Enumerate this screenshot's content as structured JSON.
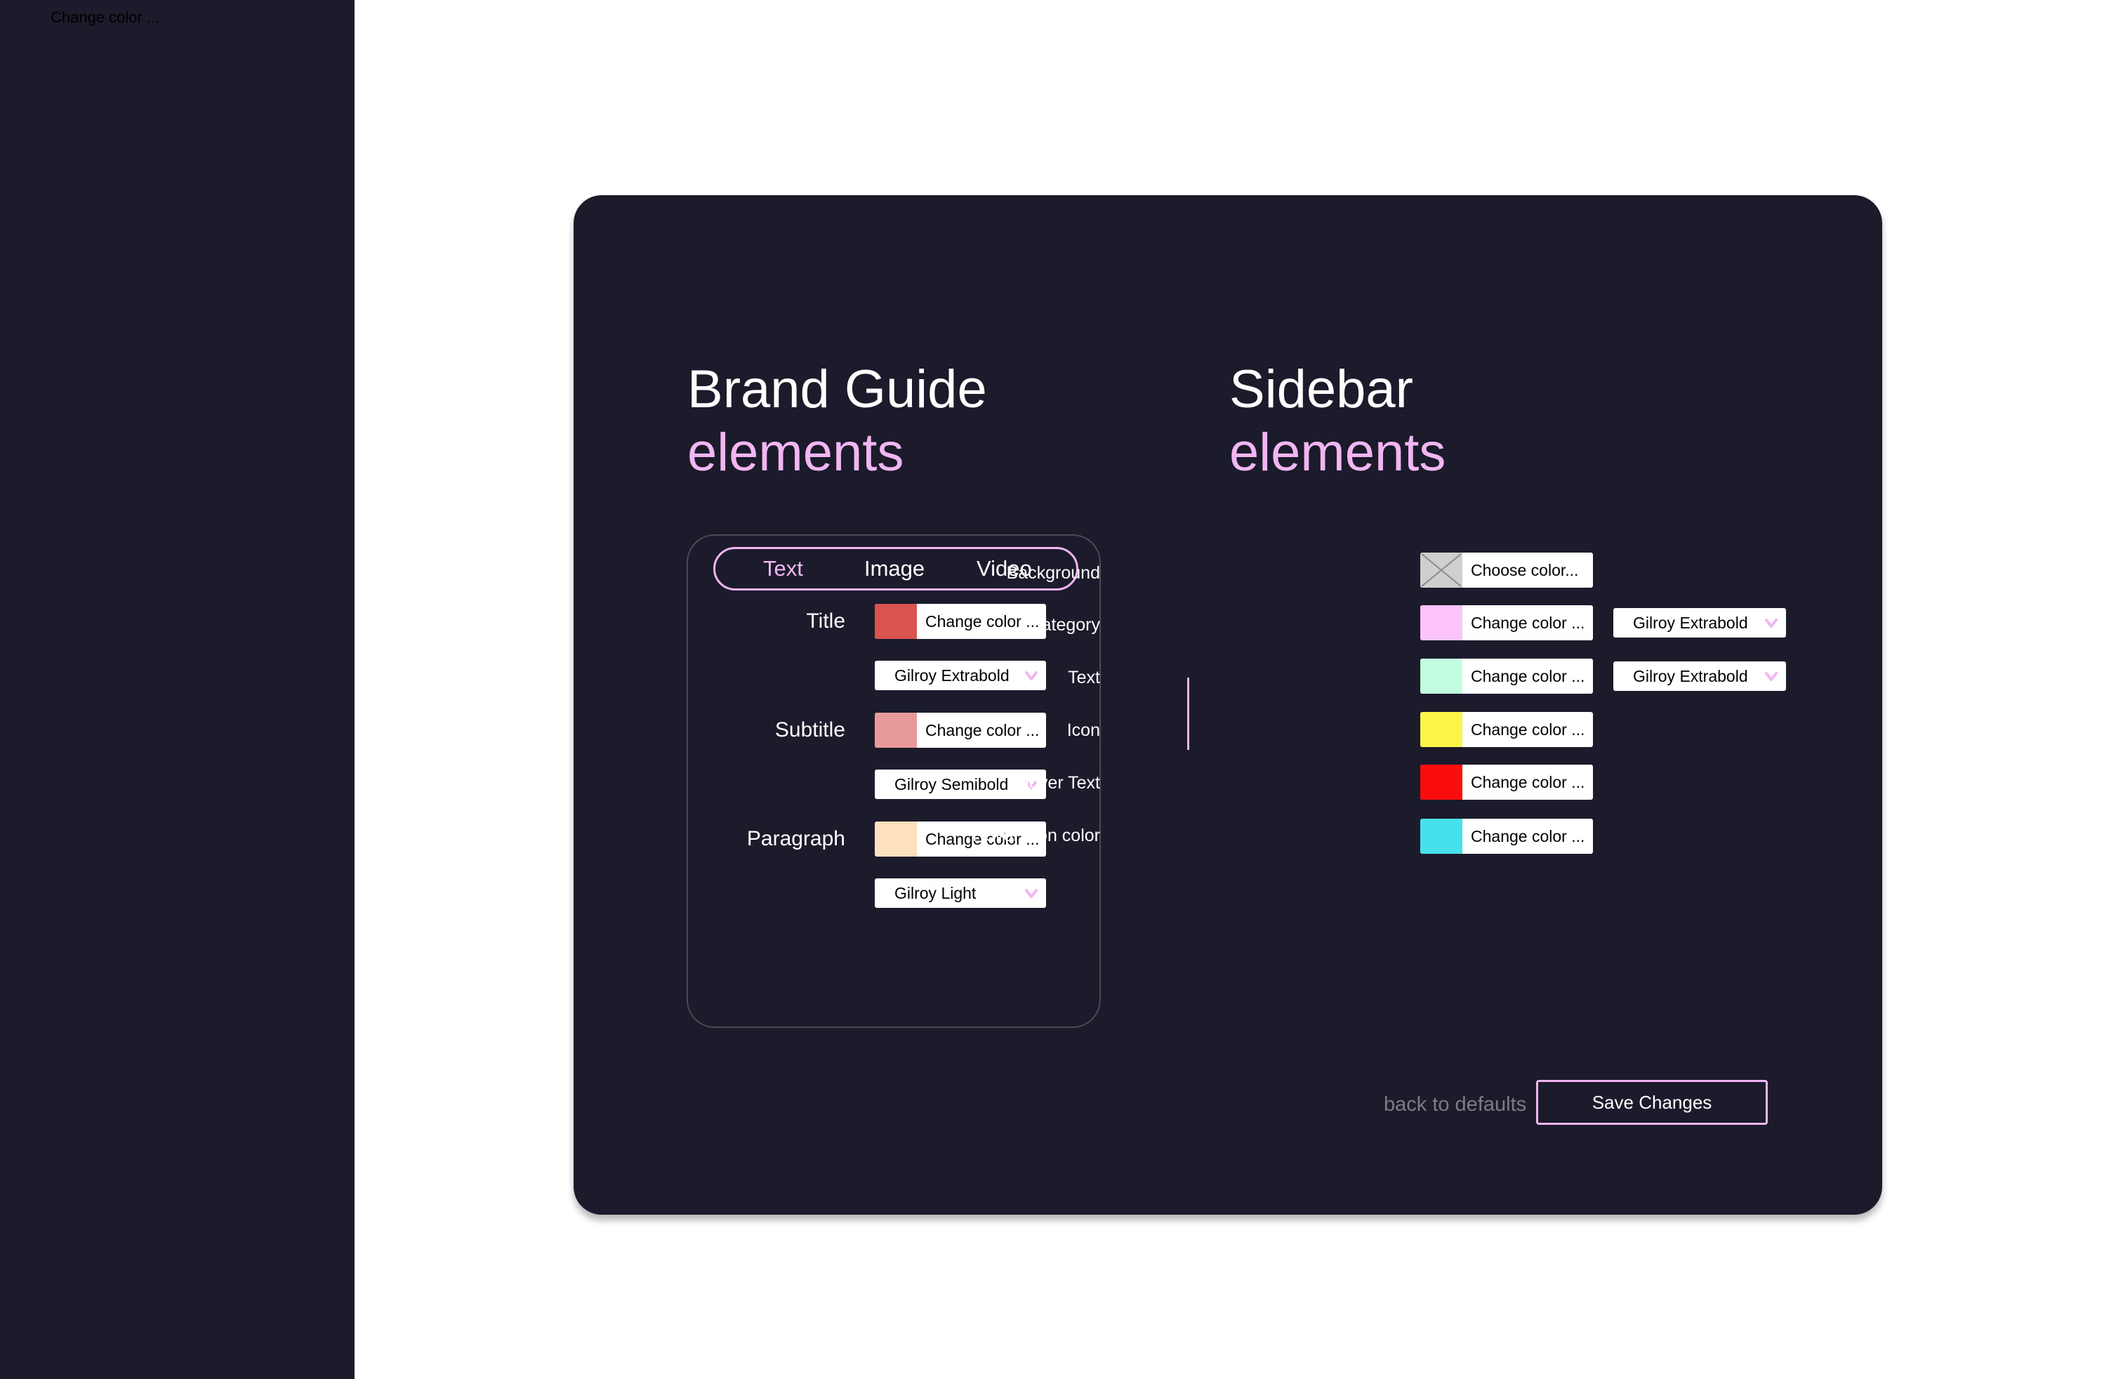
{
  "corner_label": "Change color ...",
  "brand": {
    "title_line1": "Brand Guide",
    "title_line2": "elements",
    "tabs": [
      {
        "label": "Text",
        "active": true
      },
      {
        "label": "Image",
        "active": false
      },
      {
        "label": "Video",
        "active": false
      }
    ],
    "rows": [
      {
        "label": "Title",
        "color_button": "Change color ...",
        "swatch": "#d9534f",
        "font": "Gilroy Extrabold"
      },
      {
        "label": "Subtitle",
        "color_button": "Change color ...",
        "swatch": "#e89a99",
        "font": "Gilroy Semibold"
      },
      {
        "label": "Paragraph",
        "color_button": "Change color ...",
        "swatch": "#fde0bd",
        "font": "Gilroy Light"
      }
    ]
  },
  "sidebar": {
    "title_line1": "Sidebar",
    "title_line2": "elements",
    "rows": [
      {
        "label": "Background",
        "color_button": "Choose color...",
        "swatch": "placeholder"
      },
      {
        "label": "Category",
        "color_button": "Change color ...",
        "swatch": "#fcc4fb",
        "font": "Gilroy Extrabold"
      },
      {
        "label": "Text",
        "color_button": "Change color ...",
        "swatch": "#c3fde0",
        "font": "Gilroy Extrabold"
      },
      {
        "label": "Icon",
        "color_button": "Change color ...",
        "swatch": "#fcf54a"
      },
      {
        "label": "Hover Text",
        "color_button": "Change color ...",
        "swatch": "#fb0d0d"
      },
      {
        "label": "Hover Icon color",
        "color_button": "Change color ...",
        "swatch": "#46e1ea"
      }
    ]
  },
  "actions": {
    "defaults_label": "back to defaults",
    "save_label": "Save Changes"
  },
  "colors": {
    "background": "#1b1b2b",
    "accent": "#f2b6f2",
    "muted": "#7b7b88"
  },
  "icons": {
    "dropdown": "chevron-down-icon",
    "placeholder": "empty-image-icon"
  }
}
